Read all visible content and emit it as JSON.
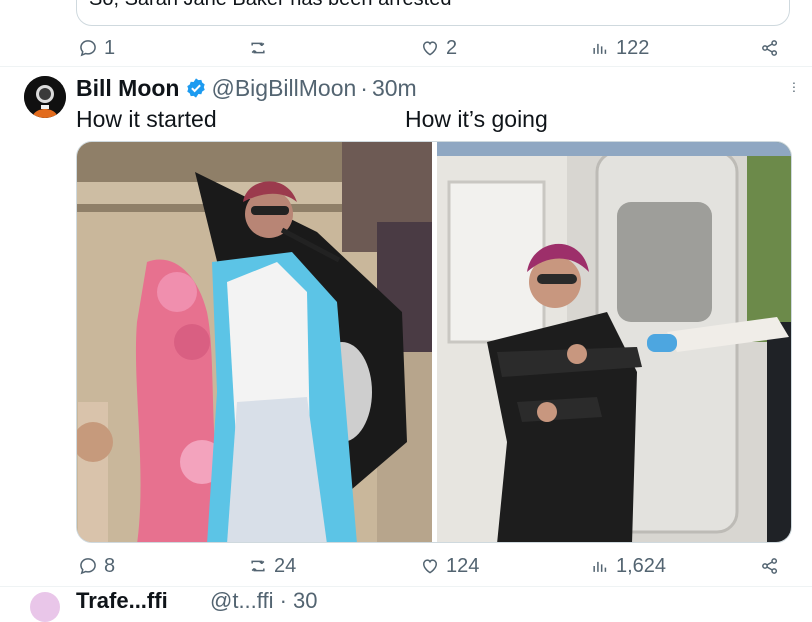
{
  "quoted_tweet": {
    "text": "So, Sarah Jane Baker has been arrested"
  },
  "previous_tweet_actions": {
    "replies": "1",
    "likes": "2",
    "views": "122"
  },
  "tweet": {
    "display_name": "Bill Moon",
    "handle": "@BigBillMoon",
    "separator": "·",
    "time": "30m",
    "caption_left": "How it started",
    "caption_right": "How it’s going",
    "actions": {
      "replies": "8",
      "reposts": "24",
      "likes": "124",
      "views": "1,624"
    }
  },
  "next_tweet": {
    "display_name": "Trafe...ffi",
    "handle": "@t...ffi · 30"
  },
  "colors": {
    "text": "#0f1419",
    "muted": "#536471",
    "divider": "#eff3f4",
    "verified": "#1d9bf0"
  },
  "icons": [
    "reply-icon",
    "repost-icon",
    "like-icon",
    "views-icon",
    "share-icon",
    "verified-badge-icon",
    "more-icon"
  ]
}
